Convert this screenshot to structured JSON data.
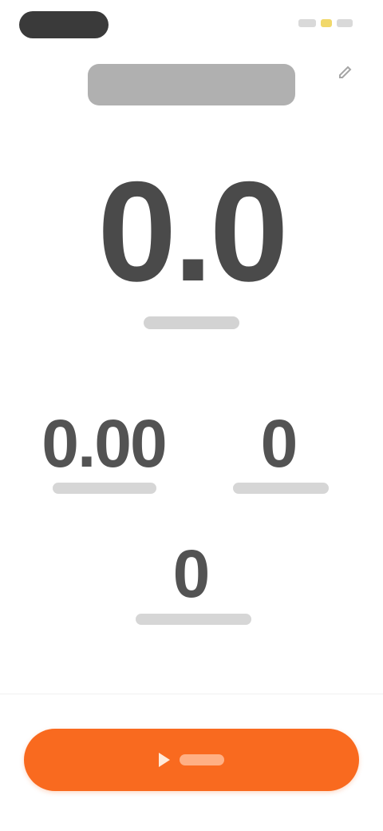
{
  "status_bar": {
    "time_pill": "",
    "icons": [
      "signal-icon",
      "wifi-icon",
      "battery-icon"
    ]
  },
  "header": {
    "title": "",
    "edit_icon": "edit-icon"
  },
  "main_metric": {
    "value": "0.0",
    "label": ""
  },
  "stats": [
    {
      "value": "0.00",
      "label": ""
    },
    {
      "value": "0",
      "label": ""
    },
    {
      "value": "0",
      "label": ""
    }
  ],
  "action": {
    "start_label": "",
    "icon": "play-icon"
  },
  "colors": {
    "accent": "#f96a1f",
    "text": "#4a4a4a"
  }
}
